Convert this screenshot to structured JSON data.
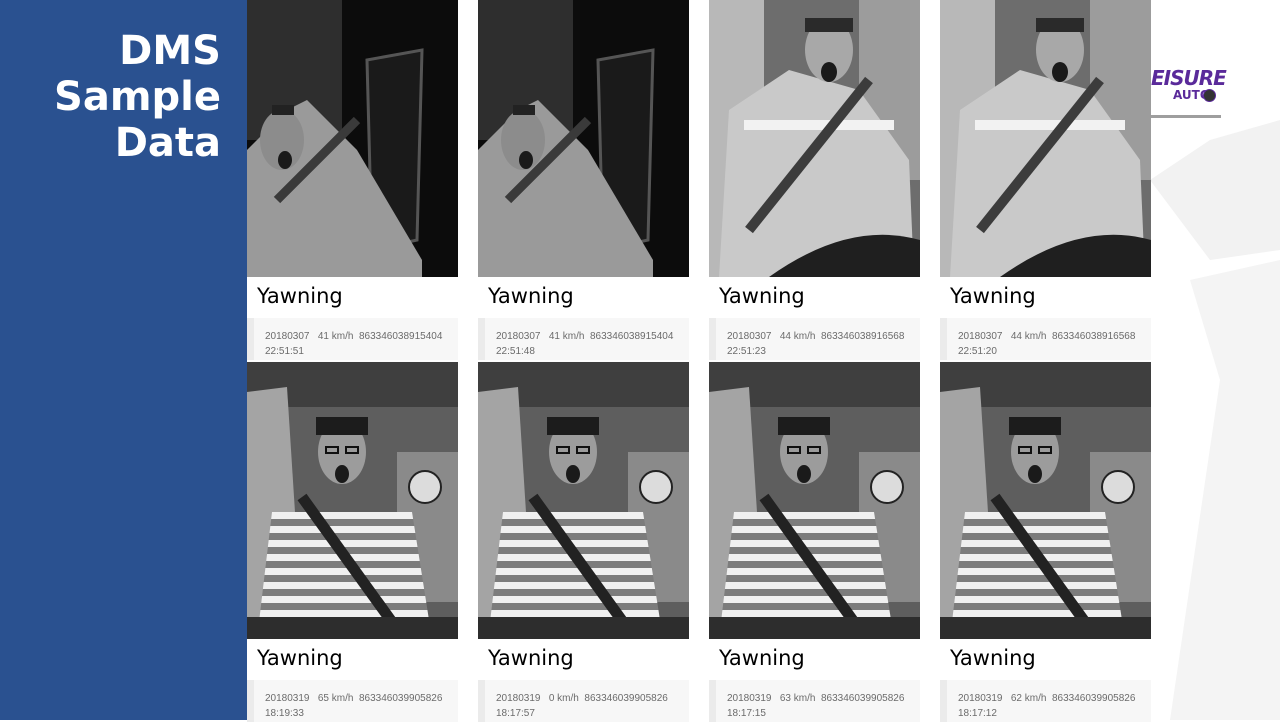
{
  "slide": {
    "title": "DMS\nSample\nData",
    "logo": {
      "text_top": "EISURE",
      "text_bottom": "AUTO"
    },
    "colors": {
      "sidebar": "#2a5190",
      "logo": "#5a2a9a"
    }
  },
  "rows": [
    {
      "cards": [
        {
          "label": "Yawning",
          "date": "20180307",
          "speed": "41 km/h",
          "id": "863346038915404",
          "time": "22:51:51",
          "scene": "night"
        },
        {
          "label": "Yawning",
          "date": "20180307",
          "speed": "41 km/h",
          "id": "863346038915404",
          "time": "22:51:48",
          "scene": "night"
        },
        {
          "label": "Yawning",
          "date": "20180307",
          "speed": "44 km/h",
          "id": "863346038916568",
          "time": "22:51:23",
          "scene": "day-jacket"
        },
        {
          "label": "Yawning",
          "date": "20180307",
          "speed": "44 km/h",
          "id": "863346038916568",
          "time": "22:51:20",
          "scene": "day-jacket"
        }
      ]
    },
    {
      "cards": [
        {
          "label": "Yawning",
          "date": "20180319",
          "speed": "65 km/h",
          "id": "863346039905826",
          "time": "18:19:33",
          "scene": "striped"
        },
        {
          "label": "Yawning",
          "date": "20180319",
          "speed": "0 km/h",
          "id": "863346039905826",
          "time": "18:17:57",
          "scene": "striped"
        },
        {
          "label": "Yawning",
          "date": "20180319",
          "speed": "63 km/h",
          "id": "863346039905826",
          "time": "18:17:15",
          "scene": "striped"
        },
        {
          "label": "Yawning",
          "date": "20180319",
          "speed": "62 km/h",
          "id": "863346039905826",
          "time": "18:17:12",
          "scene": "striped"
        }
      ]
    }
  ]
}
